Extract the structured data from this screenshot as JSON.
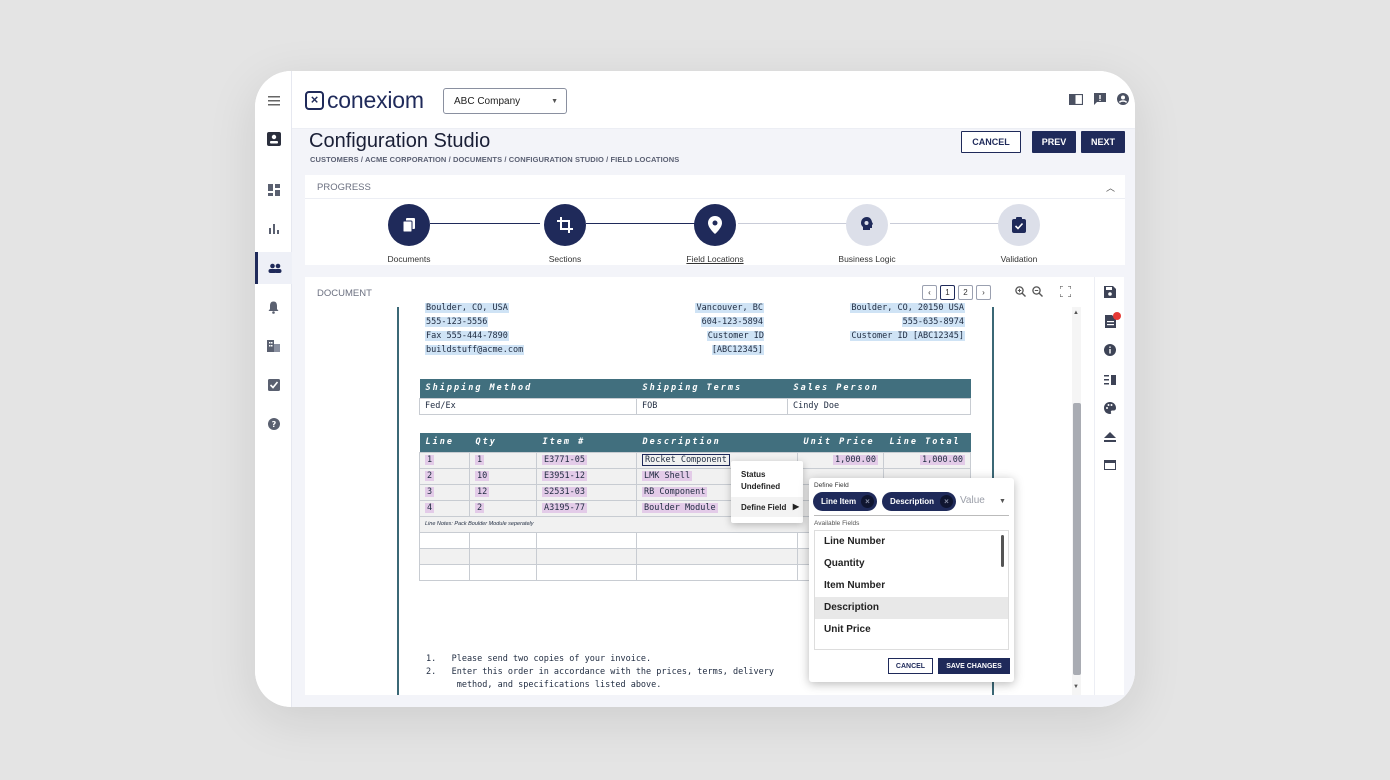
{
  "app": {
    "brand": "conexiom",
    "company_select": "ABC Company",
    "top_icons": [
      "book-icon",
      "feedback-icon",
      "account-icon"
    ]
  },
  "sidebar": {
    "items": [
      {
        "icon": "menu-icon"
      },
      {
        "icon": "contact-card-icon"
      },
      {
        "icon": "dashboard-icon"
      },
      {
        "icon": "bar-chart-icon"
      },
      {
        "icon": "people-icon",
        "active": true
      },
      {
        "icon": "bell-icon"
      },
      {
        "icon": "building-icon"
      },
      {
        "icon": "checklist-icon"
      },
      {
        "icon": "help-icon"
      }
    ]
  },
  "header": {
    "title": "Configuration Studio",
    "breadcrumb": "CUSTOMERS  /  ACME CORPORATION  /  DOCUMENTS  /  CONFIGURATION STUDIO  /  FIELD LOCATIONS",
    "cancel_label": "CANCEL",
    "prev_label": "PREV",
    "next_label": "NEXT"
  },
  "progress": {
    "title": "PROGRESS",
    "steps": [
      {
        "label": "Documents",
        "state": "done",
        "icon": "documents-icon"
      },
      {
        "label": "Sections",
        "state": "done",
        "icon": "crop-icon"
      },
      {
        "label": "Field Locations",
        "state": "current",
        "icon": "location-pin-icon"
      },
      {
        "label": "Business Logic",
        "state": "todo",
        "icon": "logic-gear-icon"
      },
      {
        "label": "Validation",
        "state": "todo",
        "icon": "clipboard-check-icon"
      }
    ]
  },
  "document": {
    "title": "DOCUMENT",
    "pages": [
      "1",
      "2"
    ],
    "current_page": "1",
    "pager_prev": "‹",
    "pager_next": "›",
    "address": {
      "left": [
        "Boulder, CO, USA",
        "555-123-5556",
        "Fax 555-444-7890",
        "buildstuff@acme.com"
      ],
      "middle": [
        "Vancouver, BC",
        "604-123-5894",
        "Customer ID [ABC12345]"
      ],
      "right": [
        "Boulder, CO, 20150 USA",
        "555-635-8974",
        "Customer ID [ABC12345]"
      ]
    },
    "shipping": {
      "headers": [
        "Shipping Method",
        "Shipping Terms",
        "Sales Person"
      ],
      "values": [
        "Fed/Ex",
        "FOB",
        "Cindy Doe"
      ]
    },
    "lines": {
      "headers": [
        "Line",
        "Qty",
        "Item #",
        "Description",
        "Unit Price",
        "Line Total"
      ],
      "rows": [
        [
          "1",
          "1",
          "E3771-05",
          "Rocket Component",
          "1,000.00",
          "1,000.00"
        ],
        [
          "2",
          "10",
          "E3951-12",
          "LMK Shell",
          "",
          ""
        ],
        [
          "3",
          "12",
          "S2531-03",
          "RB Component",
          "",
          ""
        ],
        [
          "4",
          "2",
          "A3195-77",
          "Boulder Module",
          "",
          ""
        ]
      ],
      "note": "Line Notes: Pack Boulder Module seperately"
    },
    "notes": [
      "1.   Please send two copies of your invoice.",
      "2.   Enter this order in accordance with the prices, terms, delivery",
      "      method, and specifications listed above."
    ]
  },
  "context_menu": {
    "status_label": "Status",
    "status_value": "Undefined",
    "define_label": "Define Field"
  },
  "define_field": {
    "title": "Define Field",
    "chips": [
      "Line Item",
      "Description"
    ],
    "value_placeholder": "Value",
    "available_label": "Available Fields",
    "fields": [
      "Line Number",
      "Quantity",
      "Item Number",
      "Description",
      "Unit Price"
    ],
    "selected_field": "Description",
    "cancel_label": "CANCEL",
    "save_label": "SAVE CHANGES"
  },
  "right_tools": [
    "save-icon",
    "document-alert-icon",
    "info-icon",
    "columns-icon",
    "palette-icon",
    "eject-icon",
    "window-icon"
  ],
  "colors": {
    "brand_navy": "#1f2a5a",
    "table_header": "#416f7e",
    "highlight_blue": "#cfe3f5",
    "highlight_purple": "#e3cbe8",
    "alert_red": "#e53935"
  }
}
